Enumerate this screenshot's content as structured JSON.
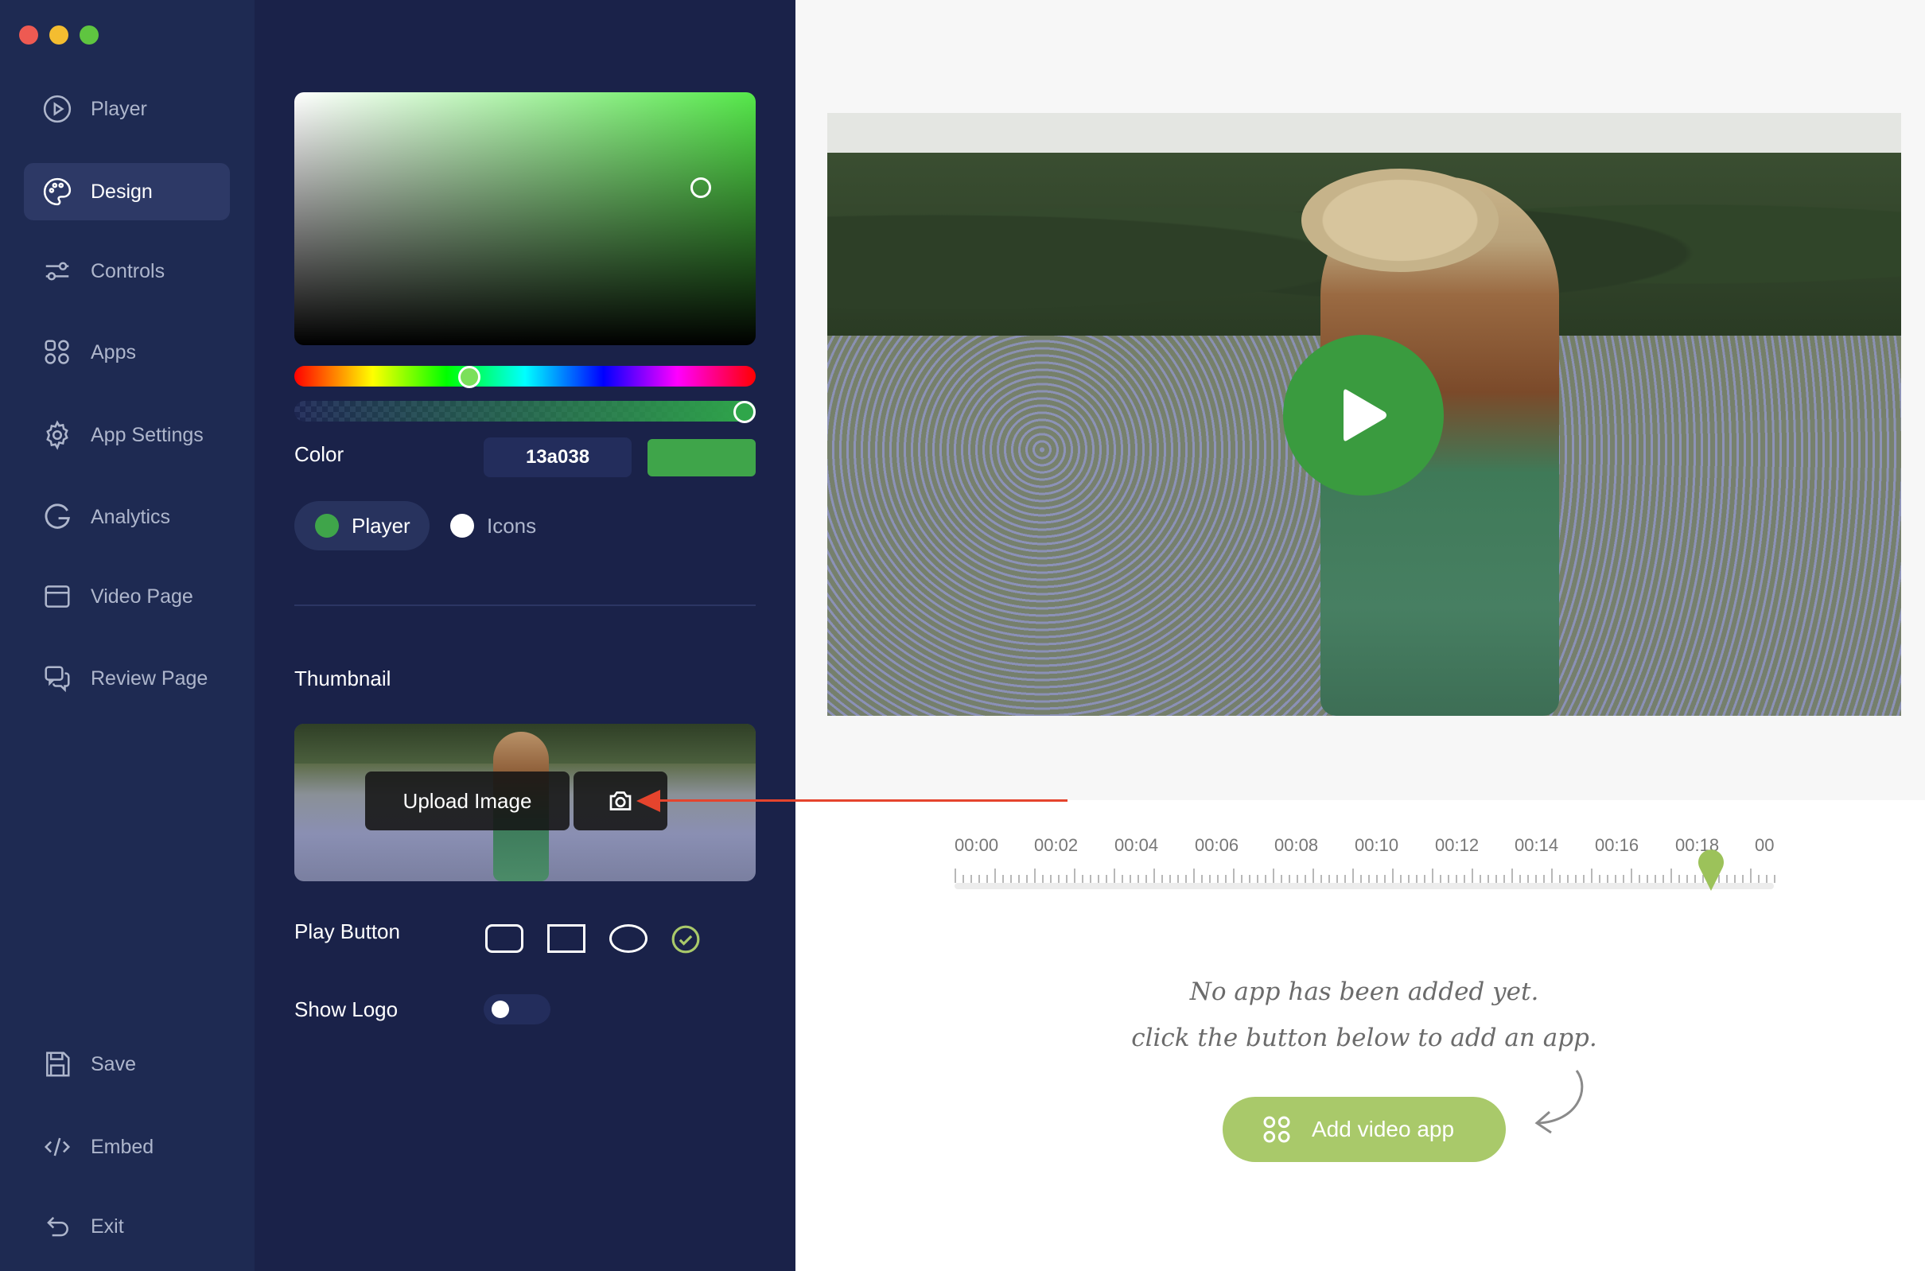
{
  "nav": {
    "items": [
      {
        "label": "Player",
        "icon": "play-circle-icon"
      },
      {
        "label": "Design",
        "icon": "palette-icon"
      },
      {
        "label": "Controls",
        "icon": "sliders-icon"
      },
      {
        "label": "Apps",
        "icon": "apps-grid-icon"
      },
      {
        "label": "App Settings",
        "icon": "gear-icon"
      },
      {
        "label": "Analytics",
        "icon": "analytics-g-icon"
      },
      {
        "label": "Video Page",
        "icon": "browser-window-icon"
      },
      {
        "label": "Review Page",
        "icon": "chat-bubbles-icon"
      }
    ],
    "bottom": [
      {
        "label": "Save",
        "icon": "floppy-disk-icon"
      },
      {
        "label": "Embed",
        "icon": "code-icon"
      },
      {
        "label": "Exit",
        "icon": "undo-arrow-icon"
      }
    ],
    "active": "Design"
  },
  "design": {
    "color_label": "Color",
    "hex_value": "13a038",
    "swatch_color": "#3fa54a",
    "hue_position": 0.38,
    "alpha_position": 1.0,
    "targets": [
      {
        "label": "Player",
        "dot_color": "#3fa54a",
        "selected": true
      },
      {
        "label": "Icons",
        "dot_color": "#ffffff",
        "selected": false
      }
    ],
    "thumbnail_label": "Thumbnail",
    "upload_label": "Upload Image",
    "play_button_label": "Play Button",
    "play_button_shapes": [
      "rounded-square",
      "square",
      "oval",
      "circle-check"
    ],
    "play_button_selected": "circle-check",
    "show_logo_label": "Show Logo",
    "show_logo_on": false
  },
  "timeline": {
    "labels": [
      "00:00",
      "00:02",
      "00:04",
      "00:06",
      "00:08",
      "00:10",
      "00:12",
      "00:14",
      "00:16",
      "00:18",
      "00"
    ],
    "playhead_color": "#9cc25a"
  },
  "apps": {
    "empty_line1": "No app has been added yet.",
    "empty_line2": "click the button below to add an app.",
    "add_button_label": "Add video app",
    "accent": "#a9c96a"
  },
  "colors": {
    "nav_bg": "#1e2a52",
    "panel_bg": "#1a2249",
    "play_green": "#3a9b3f",
    "annotation_red": "#e5442d"
  }
}
